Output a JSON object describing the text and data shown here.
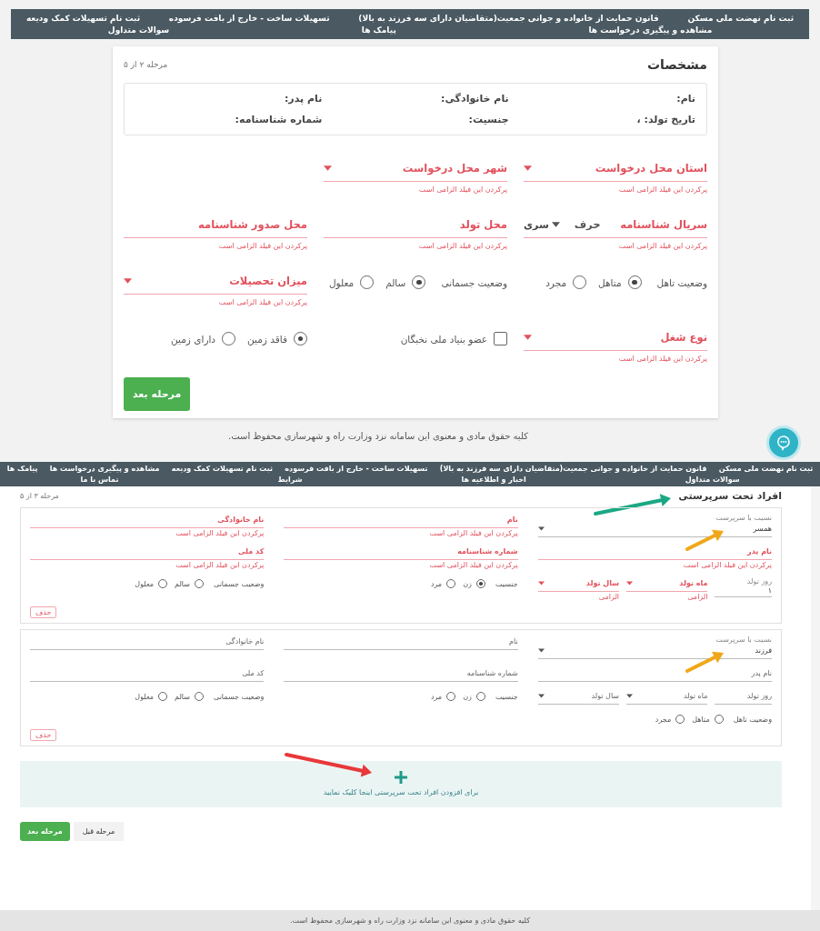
{
  "screen_1": {
    "nav": [
      "ثبت نام نهضت ملی مسکن",
      "قانون حمایت از خانواده و جوانی جمعیت(متقاضیان دارای سه فرزند به بالا)",
      "تسهیلات ساخت - خارج از بافت فرسوده",
      "ثبت نام تسهیلات کمک ودیعه",
      "مشاهده و پیگیری درخواست ها",
      "پیامک ها",
      "سوالات متداول"
    ],
    "title": "مشخصات",
    "step": "مرحله ۲ از ۵",
    "summary": [
      "نام:",
      "نام خانوادگی:",
      "نام پدر:",
      "تاریخ تولد: ،",
      "جنسیت:",
      "شماره شناسنامه:"
    ],
    "rows": [
      [
        {
          "kind": "select",
          "label": "استان محل درخواست",
          "error": "پرکردن این فیلد الزامی است"
        },
        {
          "kind": "select",
          "label": "شهر محل درخواست",
          "error": "پرکردن این فیلد الزامی است"
        }
      ],
      [
        {
          "kind": "serial",
          "label": "سریال شناسنامه",
          "letter": "حرف",
          "series": "سری",
          "error": "پرکردن این فیلد الزامی است"
        },
        {
          "kind": "text",
          "label": "محل تولد",
          "error": "پرکردن این فیلد الزامی است"
        },
        {
          "kind": "text",
          "label": "محل صدور شناسنامه",
          "error": "پرکردن این فیلد الزامی است"
        }
      ],
      [
        {
          "kind": "radio",
          "label": "وضعیت تاهل",
          "options": [
            {
              "label": "متاهل",
              "selected": true
            },
            {
              "label": "مجرد",
              "selected": false
            }
          ]
        },
        {
          "kind": "radio",
          "label": "وضعیت جسمانی",
          "options": [
            {
              "label": "سالم",
              "selected": true
            },
            {
              "label": "معلول",
              "selected": false
            }
          ]
        },
        {
          "kind": "select",
          "label": "میزان تحصیلات",
          "error": "پرکردن این فیلد الزامی است"
        }
      ],
      [
        {
          "kind": "select",
          "label": "نوع شغل",
          "error": "پرکردن این فیلد الزامی است"
        },
        {
          "kind": "checkbox",
          "label": "عضو بنیاد ملی نخبگان",
          "checked": false
        },
        {
          "kind": "radio",
          "options": [
            {
              "label": "فاقد زمین",
              "selected": true
            },
            {
              "label": "دارای زمین",
              "selected": false
            }
          ]
        }
      ]
    ],
    "next_button": "مرحله بعد",
    "footer": "کلیه حقوق مادی و معنوی این سامانه نزد وزارت راه و شهرسازی محفوظ است."
  },
  "screen_2": {
    "nav": [
      "ثبت نام نهضت ملی مسکن",
      "قانون حمایت از خانواده و جوانی جمعیت(متقاضیان دارای سه فرزند به بالا)",
      "تسهیلات ساخت - خارج از بافت فرسوده",
      "ثبت نام تسهیلات کمک ودیعه",
      "مشاهده و پیگیری درخواست ها",
      "پیامک ها",
      "سوالات متداول",
      "اخبار و اطلاعیه ها",
      "شرایط",
      "تماس با ما"
    ],
    "title": "افراد تحت سرپرستی",
    "step": "مرحله ۳ از ۵",
    "members": [
      {
        "rows": [
          [
            {
              "kind": "select",
              "caption": "نسبت با سرپرست",
              "value": "همسر"
            },
            {
              "kind": "text",
              "label": "نام",
              "error": "پرکردن این فیلد الزامی است"
            },
            {
              "kind": "text",
              "label": "نام خانوادگی",
              "error": "پرکردن این فیلد الزامی است"
            }
          ],
          [
            {
              "kind": "text",
              "label": "نام پدر",
              "error": "پرکردن این فیلد الزامی است"
            },
            {
              "kind": "text",
              "label": "شماره شناسنامه",
              "error": "پرکردن این فیلد الزامی است"
            },
            {
              "kind": "text",
              "label": "کد ملی",
              "error": "پرکردن این فیلد الزامی است"
            }
          ],
          [
            {
              "kind": "birth",
              "label": "روز تولد",
              "day": "۱",
              "month": {
                "label": "ماه تولد",
                "error": "الزامی"
              },
              "year": {
                "label": "سال تولد",
                "error": "الزامی"
              }
            },
            {
              "kind": "radio",
              "label": "جنسیت",
              "options": [
                {
                  "label": "زن",
                  "selected": true
                },
                {
                  "label": "مرد",
                  "selected": false
                }
              ]
            },
            {
              "kind": "radio",
              "label": "وضعیت جسمانی",
              "options": [
                {
                  "label": "سالم",
                  "selected": false
                },
                {
                  "label": "معلول",
                  "selected": false
                }
              ]
            }
          ]
        ],
        "delete": "حذف"
      },
      {
        "rows": [
          [
            {
              "kind": "select",
              "caption": "نسبت با سرپرست",
              "value": "فرزند"
            },
            {
              "kind": "text",
              "label": "نام"
            },
            {
              "kind": "text",
              "label": "نام خانوادگی"
            }
          ],
          [
            {
              "kind": "text",
              "label": "نام پدر"
            },
            {
              "kind": "text",
              "label": "شماره شناسنامه"
            },
            {
              "kind": "text",
              "label": "کد ملی"
            }
          ],
          [
            {
              "kind": "birth",
              "label": "روز تولد",
              "month": {
                "label": "ماه تولد"
              },
              "year": {
                "label": "سال تولد"
              }
            },
            {
              "kind": "radio",
              "label": "جنسیت",
              "options": [
                {
                  "label": "زن",
                  "selected": false
                },
                {
                  "label": "مرد",
                  "selected": false
                }
              ]
            },
            {
              "kind": "radio",
              "label": "وضعیت جسمانی",
              "options": [
                {
                  "label": "سالم",
                  "selected": false
                },
                {
                  "label": "معلول",
                  "selected": false
                }
              ]
            }
          ],
          [
            {
              "kind": "radio",
              "label": "وضعیت تاهل",
              "options": [
                {
                  "label": "متاهل",
                  "selected": false
                },
                {
                  "label": "مجرد",
                  "selected": false
                }
              ]
            }
          ]
        ],
        "delete": "حذف"
      }
    ],
    "add_hint": "برای افزودن افراد تحت سرپرستی اینجا کلیک نمایید",
    "prev_button": "مرحله قبل",
    "next_button": "مرحله بعد",
    "footer": "کلیه حقوق مادی و معنوی این سامانه نزد وزارت راه و شهرسازی محفوظ است."
  }
}
